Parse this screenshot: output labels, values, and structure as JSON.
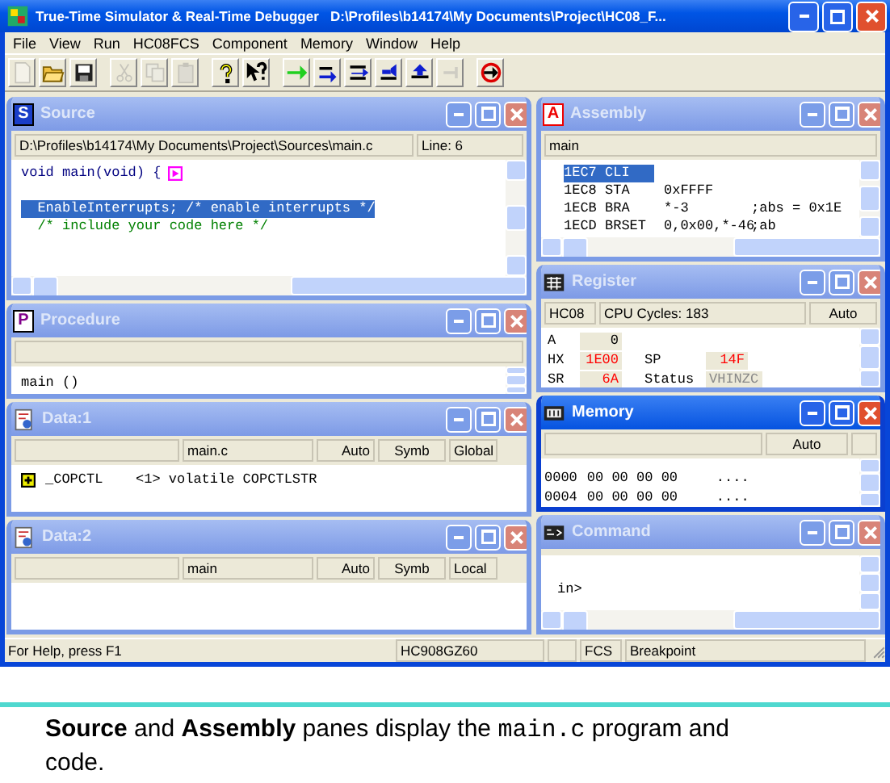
{
  "window": {
    "title": "True-Time Simulator & Real-Time Debugger   D:\\Profiles\\b14174\\My Documents\\Project\\HC08_F..."
  },
  "menu": [
    "File",
    "View",
    "Run",
    "HC08FCS",
    "Component",
    "Memory",
    "Window",
    "Help"
  ],
  "toolbar": [
    {
      "buttons": [
        {
          "kind": "new",
          "disabled": true
        },
        {
          "kind": "open",
          "disabled": false
        },
        {
          "kind": "save",
          "disabled": false
        }
      ]
    },
    {
      "buttons": [
        {
          "kind": "cut",
          "disabled": true
        },
        {
          "kind": "copy",
          "disabled": true
        },
        {
          "kind": "paste",
          "disabled": true
        }
      ]
    },
    {
      "buttons": [
        {
          "kind": "help",
          "disabled": false
        },
        {
          "kind": "context-help",
          "disabled": false
        }
      ]
    },
    {
      "buttons": [
        {
          "kind": "start",
          "disabled": false
        },
        {
          "kind": "step-in",
          "disabled": false
        },
        {
          "kind": "step-over",
          "disabled": false
        },
        {
          "kind": "step-out",
          "disabled": false
        },
        {
          "kind": "assembly-step",
          "disabled": false
        },
        {
          "kind": "halt",
          "disabled": true
        }
      ]
    },
    {
      "buttons": [
        {
          "kind": "reset",
          "disabled": false
        }
      ]
    }
  ],
  "left_panes": [
    {
      "kind": "source",
      "title": "Source",
      "badge": "S",
      "active": false,
      "path": "D:\\Profiles\\b14174\\My Documents\\Project\\Sources\\main.c",
      "line": "Line: 6",
      "lines": [
        {
          "text": "void main(void) {",
          "kind": "code",
          "selected": false,
          "marker": true,
          "gap_before": false
        },
        {
          "text": "  EnableInterrupts; /* enable interrupts */",
          "kind": "code",
          "selected": true,
          "marker": false,
          "gap_before": true
        },
        {
          "text": "  /* include your code here */",
          "kind": "comment",
          "selected": false,
          "marker": false,
          "gap_before": false
        }
      ]
    },
    {
      "kind": "procedure",
      "title": "Procedure",
      "badge": "P",
      "active": false,
      "entries": [
        "main ()"
      ]
    },
    {
      "kind": "data",
      "title": "Data:1",
      "active": false,
      "columns": [
        "main.c",
        "Auto",
        "Symb",
        "Global"
      ],
      "rows": [
        {
          "name": "_COPCTL",
          "value": "<1> volatile COPCTLSTR",
          "expanded": false
        }
      ]
    },
    {
      "kind": "data",
      "title": "Data:2",
      "active": false,
      "columns": [
        "main",
        "Auto",
        "Symb",
        "Local"
      ]
    }
  ],
  "right_panes": [
    {
      "kind": "assembly",
      "title": "Assembly",
      "badge": "A",
      "active": false,
      "header": "main",
      "rows": [
        {
          "address": "1EC7",
          "mnemonic": "CLI",
          "operand": "",
          "comment": "",
          "selected": true
        },
        {
          "address": "1EC8",
          "mnemonic": "STA",
          "operand": "0xFFFF",
          "comment": "",
          "selected": false
        },
        {
          "address": "1ECB",
          "mnemonic": "BRA",
          "operand": "*-3",
          "comment": ";abs = 0x1E",
          "selected": false
        },
        {
          "address": "1ECD",
          "mnemonic": "BRSET",
          "operand": "0,0x00,*-46",
          "comment": ";ab",
          "selected": false
        }
      ]
    },
    {
      "kind": "register",
      "title": "Register",
      "active": false,
      "cpu": "HC08",
      "cycles": "CPU Cycles:  183",
      "mode": "Auto",
      "rows": [
        {
          "registers": [
            {
              "name": "A",
              "value": "0",
              "changed": false,
              "kind": "value"
            }
          ]
        },
        {
          "registers": [
            {
              "name": "HX",
              "value": "1E00",
              "changed": true,
              "kind": "value"
            },
            {
              "name": "SP",
              "value": "14F",
              "changed": true,
              "kind": "value"
            }
          ]
        },
        {
          "registers": [
            {
              "name": "SR",
              "value": "6A",
              "changed": true,
              "kind": "value"
            },
            {
              "name": "Status",
              "value": "VHINZC",
              "changed": false,
              "kind": "flags"
            }
          ]
        }
      ]
    },
    {
      "kind": "memory",
      "title": "Memory",
      "active": true,
      "mode": "Auto",
      "rows": [
        {
          "address": "0000",
          "bytes": "00 00 00 00",
          "ascii": "...."
        },
        {
          "address": "0004",
          "bytes": "00 00 00 00",
          "ascii": "...."
        }
      ]
    },
    {
      "kind": "command",
      "title": "Command",
      "active": false,
      "lines": [
        "in>"
      ]
    }
  ],
  "status_bar": [
    "For Help, press F1",
    "HC908GZ60",
    "FCS",
    "Breakpoint"
  ],
  "caption": [
    {
      "text": "**Source** and **Assembly** panes display the ",
      "kind": "prose"
    },
    {
      "text": "main.c",
      "kind": "code"
    },
    {
      "text": " program and code.",
      "kind": "prose"
    }
  ]
}
